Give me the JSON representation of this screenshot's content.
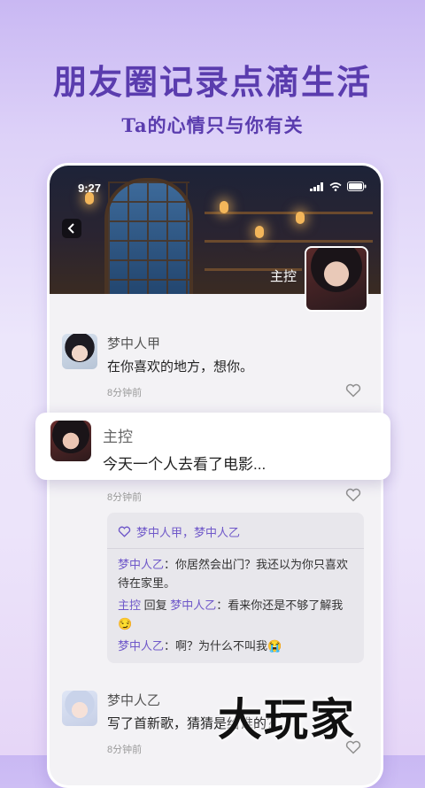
{
  "promo": {
    "headline": "朋友圈记录点滴生活",
    "subhead": "Ta的心情只与你有关"
  },
  "status_bar": {
    "time": "9:27"
  },
  "profile": {
    "name": "主控"
  },
  "posts": [
    {
      "author": "梦中人甲",
      "content": "在你喜欢的地方，想你。",
      "time": "8分钟前"
    },
    {
      "author": "主控",
      "content": "今天一个人去看了电影...",
      "time": "8分钟前"
    },
    {
      "author": "梦中人乙",
      "content": "写了首新歌，猜猜是给谁的？",
      "time": "8分钟前"
    }
  ],
  "likes": {
    "text": "梦中人甲，梦中人乙"
  },
  "comments": [
    {
      "author": "梦中人乙",
      "text": "：你居然会出门？我还以为你只喜欢待在家里。"
    },
    {
      "author": "主控",
      "reply_word": " 回复 ",
      "target": "梦中人乙",
      "text": "：看来你还是不够了解我😏"
    },
    {
      "author": "梦中人乙",
      "text": "：啊？为什么不叫我😭"
    }
  ],
  "watermark": "大玩家",
  "icons": [
    "back-arrow-icon",
    "signal-icon",
    "wifi-icon",
    "battery-icon",
    "heart-icon"
  ],
  "colors": {
    "accent": "#5a3cae",
    "link": "#6f58c9"
  }
}
